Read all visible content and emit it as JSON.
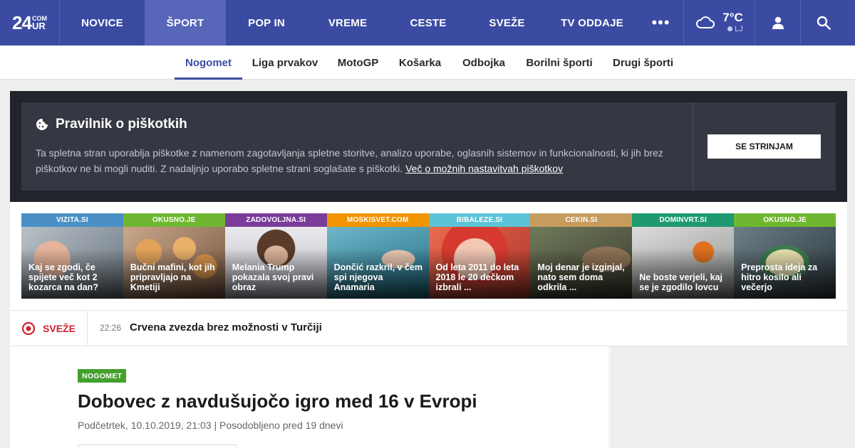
{
  "logo": {
    "number": "24",
    "top": "COM",
    "bottom": "UR"
  },
  "nav": {
    "items": [
      {
        "label": "NOVICE",
        "name": "nav-item-novice",
        "active": false,
        "width": 119
      },
      {
        "label": "ŠPORT",
        "name": "nav-item-sport",
        "active": true,
        "width": 114
      },
      {
        "label": "POP IN",
        "name": "nav-item-pop-in",
        "active": false,
        "width": 114
      },
      {
        "label": "VREME",
        "name": "nav-item-vreme",
        "active": false,
        "width": 114
      },
      {
        "label": "CESTE",
        "name": "nav-item-ceste",
        "active": false,
        "width": 112
      },
      {
        "label": "SVEŽE",
        "name": "nav-item-sveze",
        "active": false,
        "width": 109
      },
      {
        "label": "TV ODDAJE",
        "name": "nav-item-tv-oddaje",
        "active": false,
        "width": 130
      }
    ],
    "more_icon": "•••"
  },
  "weather": {
    "temp": "7°C",
    "location": "LJ",
    "icon": "cloud-icon"
  },
  "subnav": {
    "items": [
      {
        "label": "Nogomet",
        "name": "subnav-item-nogomet",
        "active": true
      },
      {
        "label": "Liga prvakov",
        "name": "subnav-item-liga-prvakov",
        "active": false
      },
      {
        "label": "MotoGP",
        "name": "subnav-item-motogp",
        "active": false
      },
      {
        "label": "Košarka",
        "name": "subnav-item-kosarka",
        "active": false
      },
      {
        "label": "Odbojka",
        "name": "subnav-item-odbojka",
        "active": false
      },
      {
        "label": "Borilni športi",
        "name": "subnav-item-borilni-sporti",
        "active": false
      },
      {
        "label": "Drugi športi",
        "name": "subnav-item-drugi-sporti",
        "active": false
      }
    ]
  },
  "cookie": {
    "title": "Pravilnik o piškotkih",
    "text": "Ta spletna stran uporablja piškotke z namenom zagotavljanja spletne storitve, analizo uporabe, oglasnih sistemov in funkcionalnosti, ki jih brez piškotkov ne bi mogli nuditi. Z nadaljnjo uporabo spletne strani soglašate s piškotki.",
    "link": "Več o možnih nastavitvah piškotkov",
    "button": "SE STRINJAM"
  },
  "partners": [
    {
      "source": "VIZITA.SI",
      "title": "Kaj se zgodi, če spijete več kot 2 kozarca na dan?",
      "color": "#4a90c4",
      "image": "photo-drinking-water"
    },
    {
      "source": "OKUSNO.JE",
      "title": "Bučni mafini, kot jih pripravljajo na Kmetiji",
      "color": "#6fb730",
      "image": "photo-muffins"
    },
    {
      "source": "ZADOVOLJNA.SI",
      "title": "Melania Trump pokazala svoj pravi obraz",
      "color": "#7a3c9a",
      "image": "photo-portrait-woman"
    },
    {
      "source": "MOSKISVET.COM",
      "title": "Dončić razkril, v čem spi njegova Anamaria",
      "color": "#f29400",
      "image": "photo-pool"
    },
    {
      "source": "BIBALEZE.SI",
      "title": "Od leta 2011 do leta 2018 le 20 dečkom izbrali ...",
      "color": "#5dc3d8",
      "image": "photo-baby"
    },
    {
      "source": "CEKIN.SI",
      "title": "Moj denar je izginjal, nato sem doma odkrila ...",
      "color": "#c69c5d",
      "image": "photo-coins"
    },
    {
      "source": "DOMINVRT.SI",
      "title": "Ne boste verjeli, kaj se je zgodilo lovcu",
      "color": "#1e9a6e",
      "image": "photo-hunter"
    },
    {
      "source": "OKUSNO.JE",
      "title": "Preprosta ideja za hitro kosilo ali večerjo",
      "color": "#6fb730",
      "image": "photo-salad"
    }
  ],
  "sveze": {
    "label": "SVEŽE",
    "time": "22:26",
    "headline": "Crvena zvezda brez možnosti v Turčiji"
  },
  "article": {
    "tag": "NOGOMET",
    "title": "Dobovec z navdušujočo igro med 16 v Evropi",
    "meta": "Podčetrtek, 10.10.2019, 21:03 | Posodobljeno pred 19 dnevi"
  },
  "colors": {
    "brand": "#3b4ba2",
    "active_nav": "#5766b8",
    "alert": "#d4202f",
    "tag": "#43a02c"
  }
}
